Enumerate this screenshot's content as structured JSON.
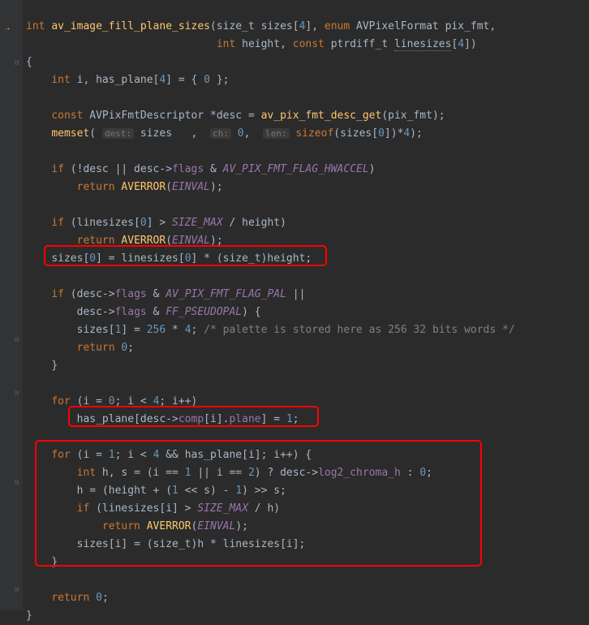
{
  "code": {
    "l1a": "int",
    "l1b": " ",
    "l1c": "av_image_fill_plane_sizes",
    "l1d": "(size_t sizes[",
    "l1e": "4",
    "l1f": "], ",
    "l1g": "enum",
    "l1h": " AVPixelFormat pix_fmt,",
    "l2a": "int",
    "l2b": " height, ",
    "l2c": "const",
    "l2d": " ptrdiff_t ",
    "l2e": "linesizes",
    "l2f": "[",
    "l2g": "4",
    "l2h": "])",
    "l3": "{",
    "l4a": "int",
    "l4b": " i, has_plane[",
    "l4c": "4",
    "l4d": "] = { ",
    "l4e": "0",
    "l4f": " };",
    "l6a": "const",
    "l6b": " AVPixFmtDescriptor *desc = ",
    "l6c": "av_pix_fmt_desc_get",
    "l6d": "(pix_fmt);",
    "l7a": "memset",
    "l7b": "(",
    "l7h1": "dest:",
    "l7c": " sizes   , ",
    "l7h2": "ch:",
    "l7d": " ",
    "l7e": "0",
    "l7f": ", ",
    "l7h3": "len:",
    "l7g": " ",
    "l7i": "sizeof",
    "l7j": "(sizes[",
    "l7k": "0",
    "l7l": "])*",
    "l7m": "4",
    "l7n": ");",
    "l9a": "if",
    "l9b": " (!desc || desc->",
    "l9c": "flags",
    "l9d": " & ",
    "l9e": "AV_PIX_FMT_FLAG_HWACCEL",
    "l9f": ")",
    "l10a": "return",
    "l10b": " ",
    "l10c": "AVERROR",
    "l10d": "(",
    "l10e": "EINVAL",
    "l10f": ");",
    "l12a": "if",
    "l12b": " (linesizes[",
    "l12c": "0",
    "l12d": "] > ",
    "l12e": "SIZE_MAX",
    "l12f": " / height)",
    "l13a": "return",
    "l13b": " ",
    "l13c": "AVERROR",
    "l13d": "(",
    "l13e": "EINVAL",
    "l13f": ");",
    "l14a": "sizes[",
    "l14b": "0",
    "l14c": "] = linesizes[",
    "l14d": "0",
    "l14e": "] * (size_t)height;",
    "l16a": "if",
    "l16b": " (desc->",
    "l16c": "flags",
    "l16d": " & ",
    "l16e": "AV_PIX_FMT_FLAG_PAL",
    "l16f": " ||",
    "l17a": "desc->",
    "l17b": "flags",
    "l17c": " & ",
    "l17d": "FF_PSEUDOPAL",
    "l17e": ") {",
    "l18a": "sizes[",
    "l18b": "1",
    "l18c": "] = ",
    "l18d": "256",
    "l18e": " * ",
    "l18f": "4",
    "l18g": "; ",
    "l18h": "/* palette is stored here as 256 32 bits words */",
    "l19a": "return",
    "l19b": " ",
    "l19c": "0",
    "l19d": ";",
    "l20": "}",
    "l22a": "for",
    "l22b": " (i = ",
    "l22c": "0",
    "l22d": "; i < ",
    "l22e": "4",
    "l22f": "; i++)",
    "l23a": "has_plane[desc->",
    "l23b": "comp",
    "l23c": "[i].",
    "l23d": "plane",
    "l23e": "] = ",
    "l23f": "1",
    "l23g": ";",
    "l25a": "for",
    "l25b": " (i = ",
    "l25c": "1",
    "l25d": "; i < ",
    "l25e": "4",
    "l25f": " && has_plane[i]; i++) {",
    "l26a": "int",
    "l26b": " h, s = (i == ",
    "l26c": "1",
    "l26d": " || i == ",
    "l26e": "2",
    "l26f": ") ? desc->",
    "l26g": "log2_chroma_h",
    "l26h": " : ",
    "l26i": "0",
    "l26j": ";",
    "l27a": "h = (height + (",
    "l27b": "1",
    "l27c": " << s) - ",
    "l27d": "1",
    "l27e": ") >> s;",
    "l28a": "if",
    "l28b": " (linesizes[i] > ",
    "l28c": "SIZE_MAX",
    "l28d": " / h)",
    "l29a": "return",
    "l29b": " ",
    "l29c": "AVERROR",
    "l29d": "(",
    "l29e": "EINVAL",
    "l29f": ");",
    "l30a": "sizes[i] = (size_t)h * linesizes[i];",
    "l31": "}",
    "l33a": "return",
    "l33b": " ",
    "l33c": "0",
    "l33d": ";",
    "l34": "}"
  }
}
